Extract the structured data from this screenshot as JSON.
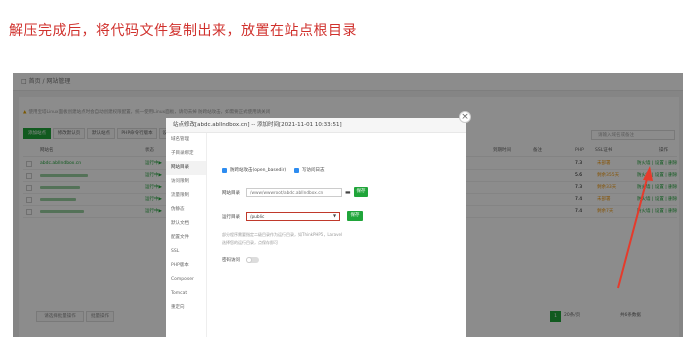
{
  "heading": "解压完成后，将代码文件复制出来，放置在站点根目录",
  "breadcrumb": "□ 首页 / 网站管理",
  "warning": "使用宝塔Linux面板创建站点时会自动创建权限配置，统一使用Linux面板，请勿去掉 防跨站攻击，如需要正式使用请关闭",
  "toolbar": [
    "添加站点",
    "修改默认页",
    "默认站点",
    "PHP命令行版本",
    "设置"
  ],
  "search_placeholder": "请输入域名或备注",
  "table_headers": [
    "网站名",
    "状态",
    "备份",
    "根目录",
    "到期时间",
    "备注",
    "PHP",
    "SSL证书",
    "操作"
  ],
  "rows": [
    {
      "status": "运行中▶",
      "php": "7.3",
      "ssl": "未部署",
      "ops": "防火墙 | 设置 | 删除"
    },
    {
      "status": "运行中▶",
      "php": "5.6",
      "ssl": "剩余355天",
      "ops": "防火墙 | 设置 | 删除"
    },
    {
      "status": "运行中▶",
      "php": "7.3",
      "ssl": "剩余33天",
      "ops": "防火墙 | 设置 | 删除"
    },
    {
      "status": "运行中▶",
      "php": "7.4",
      "ssl": "未部署",
      "ops": "防火墙 | 设置 | 删除"
    },
    {
      "status": "运行中▶",
      "php": "7.4",
      "ssl": "剩余7天",
      "ops": "防火墙 | 设置 | 删除"
    }
  ],
  "row_site": "abdc.abllndbox.cn",
  "footer_buttons": [
    "请选择批量操作",
    "批量操作"
  ],
  "pager": {
    "page": "1",
    "per_page": "20条/页",
    "total_label": "共6条数据"
  },
  "dialog": {
    "title": "站点修改[abdc.abllndbox.cn] -- 添加时间[2021-11-01 10:33:51]",
    "close": "×",
    "side_items": [
      "域名管理",
      "子目录绑定",
      "网站目录",
      "访问限制",
      "流量限制",
      "伪静态",
      "默认文档",
      "配置文件",
      "SSL",
      "PHP版本",
      "Composer",
      "Tomcat",
      "重定向"
    ],
    "active_index": 2,
    "check1": "防跨站攻击(open_basedir)",
    "check2": "写访问日志",
    "root_label": "网站目录",
    "root_value": "/www/wwwroot/abdc.abllndbox.cn",
    "save": "保存",
    "run_label": "运行目录",
    "run_value": "/public",
    "tips": [
      "部分程序需要指定二级目录作为运行目录，如ThinkPHP5，Laravel",
      "选择您的运行目录，点保存即可"
    ],
    "protect_label": "密码访问"
  }
}
